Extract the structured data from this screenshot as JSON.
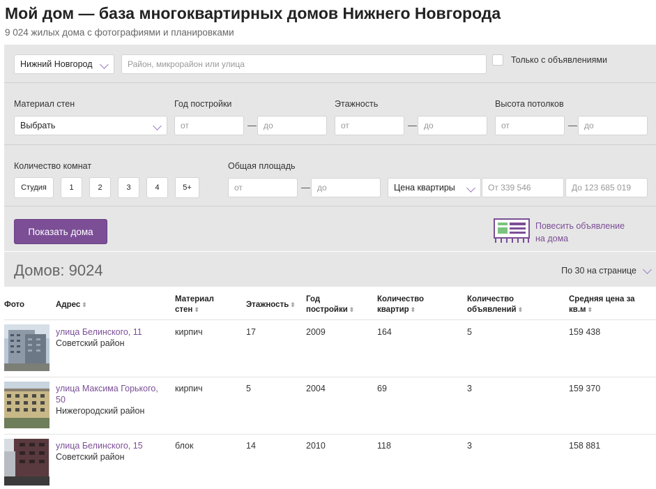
{
  "page": {
    "title": "Мой дом — база многоквартирных домов Нижнего Новгорода",
    "subtitle": "9 024 жилых дома с фотографиями и планировками"
  },
  "search": {
    "city": "Нижний Новгород",
    "placeholder": "Район, микрорайон или улица",
    "only_ads_label": "Только с объявлениями"
  },
  "filters": {
    "material_label": "Материал стен",
    "material_value": "Выбрать",
    "year_label": "Год постройки",
    "floors_label": "Этажность",
    "ceiling_label": "Высота потолков",
    "from": "от",
    "to": "до",
    "dash": "—",
    "rooms_label": "Количество комнат",
    "rooms": [
      "Студия",
      "1",
      "2",
      "3",
      "4",
      "5+"
    ],
    "area_label": "Общая площадь",
    "price_select": "Цена квартиры",
    "price_from": "От 339 546",
    "price_to": "До 123 685 019",
    "show_button": "Показать дома",
    "post_ad_line1": "Повесить объявление",
    "post_ad_line2": "на дома"
  },
  "results": {
    "count_label": "Домов: 9024",
    "per_page": "По 30 на странице"
  },
  "table": {
    "headers": {
      "photo": "Фото",
      "address": "Адрес",
      "material_1": "Материал",
      "material_2": "стен",
      "floors": "Этажность",
      "year_1": "Год",
      "year_2": "постройки",
      "flats_1": "Количество",
      "flats_2": "квартир",
      "ads_1": "Количество",
      "ads_2": "объявлений",
      "price_1": "Средняя цена за",
      "price_2": "кв.м"
    },
    "rows": [
      {
        "street": "улица Белинского, 11",
        "street2": "",
        "district": "Советский район",
        "material": "кирпич",
        "floors": "17",
        "year": "2009",
        "flats": "164",
        "ads": "5",
        "price": "159 438"
      },
      {
        "street": "улица Максима Горького,",
        "street2": "50",
        "district": "Нижегородский район",
        "material": "кирпич",
        "floors": "5",
        "year": "2004",
        "flats": "69",
        "ads": "3",
        "price": "159 370"
      },
      {
        "street": "улица Белинского, 15",
        "street2": "",
        "district": "Советский район",
        "material": "блок",
        "floors": "14",
        "year": "2010",
        "flats": "118",
        "ads": "3",
        "price": "158 881"
      }
    ]
  },
  "colors": {
    "accent": "#7b4e96",
    "panel": "#e6e6e6",
    "ad_icon_green": "#7cc47f"
  }
}
